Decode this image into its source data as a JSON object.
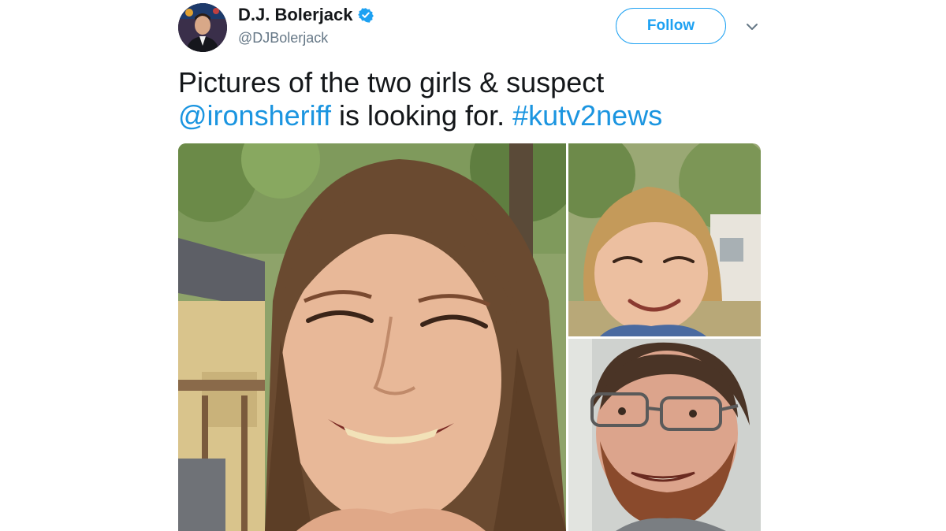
{
  "author": {
    "display_name": "D.J. Bolerjack",
    "handle": "@DJBolerjack",
    "verified": true,
    "avatar_icon": "profile-avatar"
  },
  "follow_label": "Follow",
  "menu_icon": "chevron-down-icon",
  "tweet": {
    "text_part1": "Pictures of the two girls & suspect",
    "mention": "@ironsheriff",
    "text_part2": " is looking for. ",
    "hashtag": "#kutv2news"
  },
  "colors": {
    "accent": "#1da1f2",
    "link": "#1b95e0",
    "text": "#14171a",
    "secondary": "#657786"
  },
  "media": [
    {
      "name": "photo-girl-1"
    },
    {
      "name": "photo-girl-2"
    },
    {
      "name": "photo-suspect"
    }
  ]
}
